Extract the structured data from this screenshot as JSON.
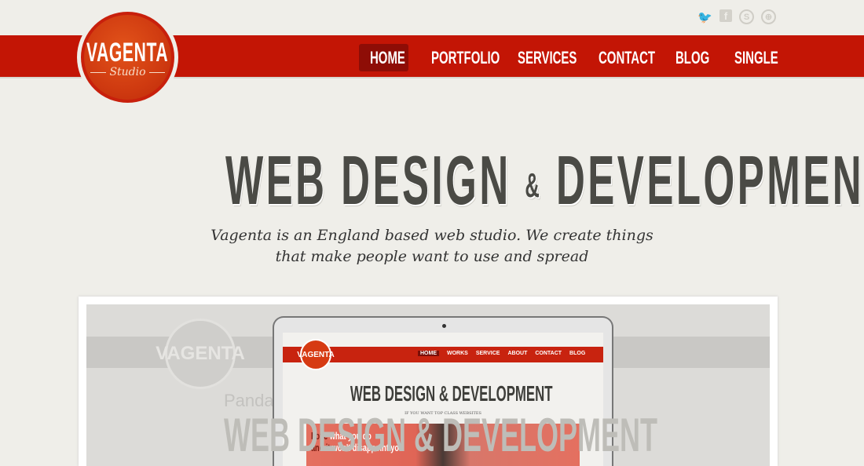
{
  "social": [
    {
      "name": "twitter",
      "glyph": "🐦"
    },
    {
      "name": "facebook",
      "glyph": "f"
    },
    {
      "name": "skype",
      "glyph": "S"
    },
    {
      "name": "dribbble",
      "glyph": "⊕"
    }
  ],
  "logo": {
    "name": "VAGENTA",
    "sub": "Studio"
  },
  "nav": [
    {
      "label": "HOME",
      "active": true
    },
    {
      "label": "PORTFOLIO"
    },
    {
      "label": "SERVICES"
    },
    {
      "label": "CONTACT"
    },
    {
      "label": "BLOG"
    },
    {
      "label": "SINGLE"
    }
  ],
  "hero": {
    "title_a": "WEB DESIGN",
    "amp": "&",
    "title_b": "DEVELOPMENT",
    "subtitle": "Vagenta is an England based web studio. We create things that make people want to use and spread"
  },
  "preview": {
    "ghost_logo": "VAGENTA",
    "ghost_text": "Panda Design Studio",
    "ghost_big": "WEB DESIGN & DEVELOPMENT",
    "mock_logo": "VAGENTA",
    "mock_nav": [
      "HOME",
      "WORKS",
      "SERVICE",
      "ABOUT",
      "CONTACT",
      "BLOG"
    ],
    "mock_title": "WEB DESIGN & DEVELOPMENT",
    "mock_tagline": "IF YOU WANT TOP CLASS WEBSITES",
    "mock_hero_a": "Love",
    "mock_hero_b": "what you do",
    "mock_hero_c": "and it",
    "mock_hero_d": "won't",
    "mock_hero_e": "disappoint you"
  },
  "colors": {
    "accent": "#c31505",
    "active_nav": "#8e0d06",
    "background": "#efeee9",
    "heading": "#4a4a45"
  }
}
